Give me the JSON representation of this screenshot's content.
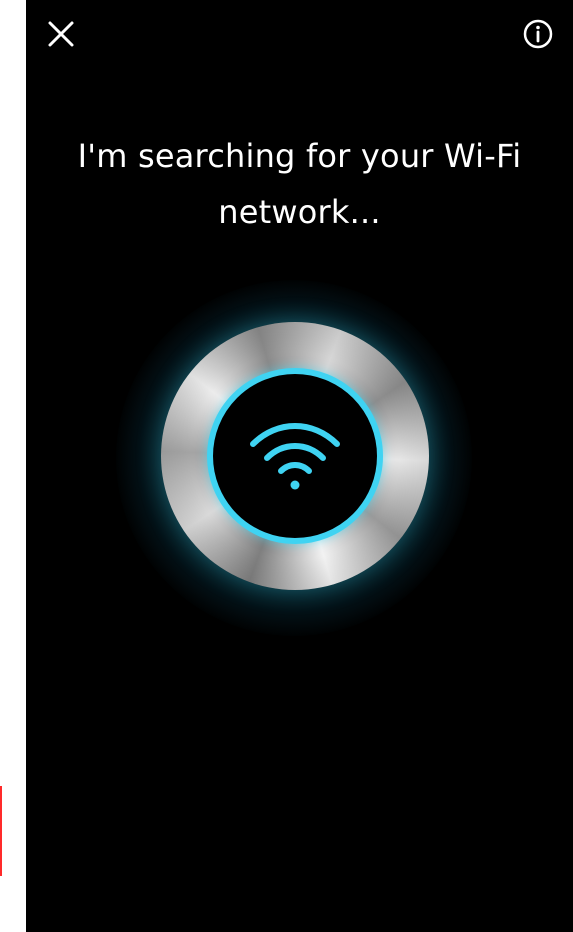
{
  "header": {
    "close_icon": "close-icon",
    "info_icon": "info-icon"
  },
  "main": {
    "title": "I'm searching for your Wi-Fi network...",
    "status_icon": "wifi-icon"
  },
  "colors": {
    "background": "#000000",
    "accent": "#3fd3f2",
    "text": "#ffffff",
    "marker": "#ff2a2a"
  }
}
